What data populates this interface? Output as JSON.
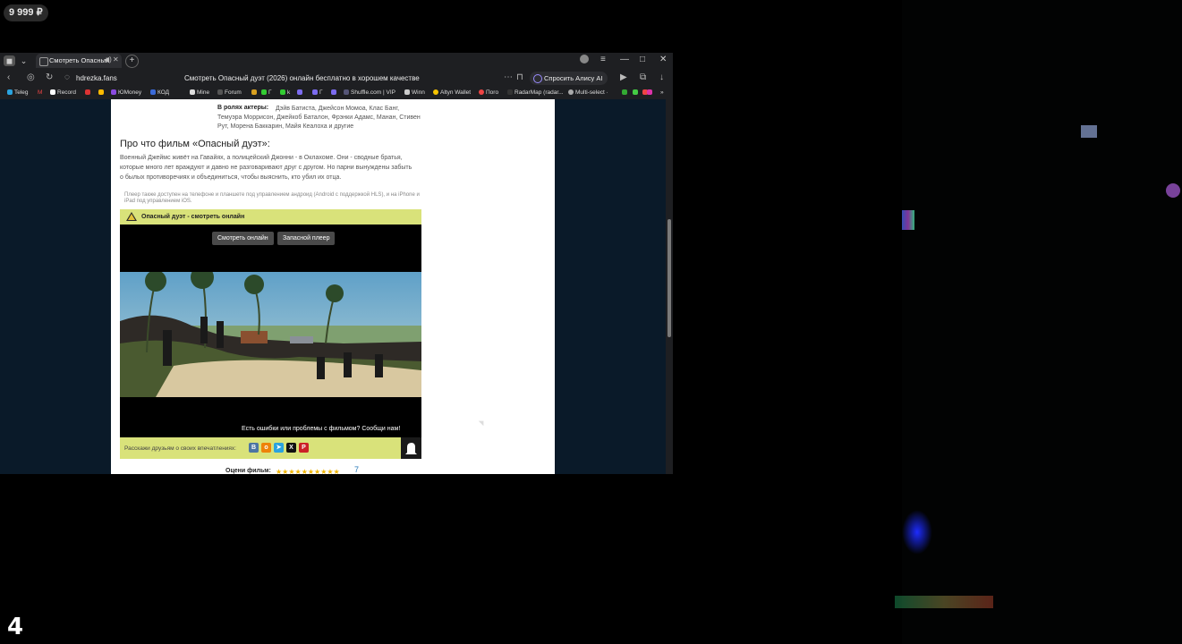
{
  "overlay": {
    "balance": "9 999 ₽",
    "stream_number": "4"
  },
  "browser": {
    "tab": {
      "title": "Смотреть Опасный"
    },
    "address": {
      "url": "hdrezka.fans",
      "page_title": "Смотреть Опасный дуэт (2026) онлайн бесплатно в хорошем качестве",
      "alice_label": "Спросить Алису AI"
    },
    "bookmarks": [
      "Teleg",
      "M",
      "Record",
      "ЮMoney",
      "КОД",
      "Mine",
      "Forum",
      "Г",
      "k",
      "Г",
      "Shuffle.com | VIP",
      "Winn",
      "Altyn Wallet",
      "Поrо",
      "RadarMap (radar...",
      "Multi-select ·"
    ],
    "bookmarks_more": "»"
  },
  "page": {
    "cast_label": "В ролях актеры:",
    "cast_text": "Дэйв Батиста, Джейсон Момоа, Клас Банг, Темуэра Моррисон, Джейкоб Баталон, Фрэнки Адамс, Манан, Стивен Рут, Морена Баккарин, Майя Кеалоха и другие",
    "about_heading": "Про что фильм «Опасный дуэт»:",
    "description": "Военный Джеймс живёт на Гавайях, а полицейский Джонни - в Оклахоме. Они - сводные братья, которые много лет враждуют и давно не разговаривают друг с другом. Но парни вынуждены забыть о былых противоречиях и объединиться, чтобы выяснить, кто убил их отца.",
    "player_note": "Плеер также доступен на телефоне и планшете под управлением андроид (Android с поддержкой HLS), и на iPhone и iPad под управлением iOS.",
    "player_header": "Опасный дуэт - смотреть онлайн",
    "watch_button": "Смотреть онлайн",
    "backup_button": "Запасной плеер",
    "report_text": "Есть ошибки или проблемы с фильмом? Сообщи нам!",
    "share_text": "Расскажи друзьям о своих впечатлениях:",
    "rating_label": "Оцени фильм:",
    "rating_value": "7",
    "stars": "★★★★★★★★★★"
  },
  "colors": {
    "accent_bar": "#d9e27a",
    "vk": "#4c75a3",
    "ok": "#ee8208",
    "telegram": "#2aa3df",
    "x": "#111111",
    "pinterest": "#cb2027"
  }
}
